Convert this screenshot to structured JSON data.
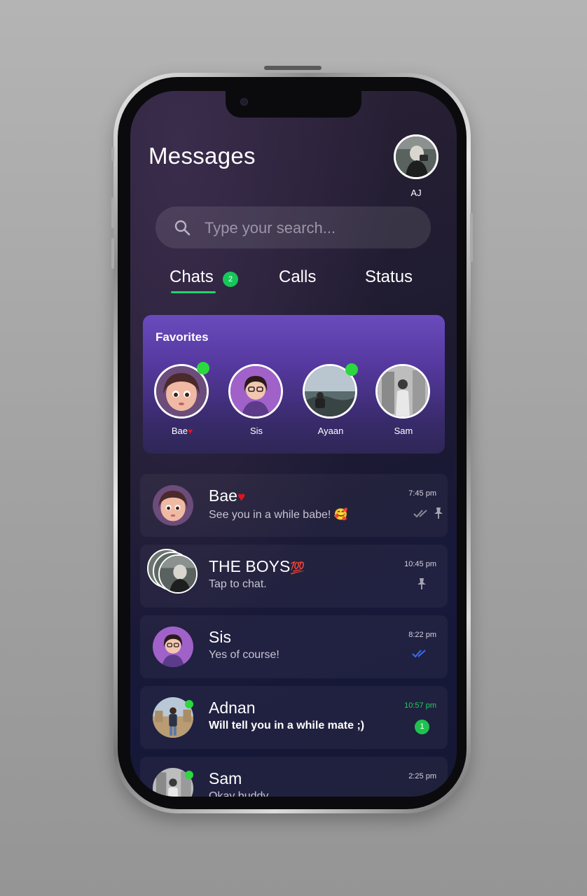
{
  "header": {
    "title": "Messages",
    "profile_initials": "AJ"
  },
  "search": {
    "placeholder": "Type your search..."
  },
  "tabs": [
    {
      "label": "Chats",
      "badge": "2",
      "active": true
    },
    {
      "label": "Calls"
    },
    {
      "label": "Status"
    }
  ],
  "favorites": {
    "title": "Favorites",
    "items": [
      {
        "name": "Bae",
        "emoji": "♥",
        "online": true
      },
      {
        "name": "Sis",
        "online": false
      },
      {
        "name": "Ayaan",
        "online": true
      },
      {
        "name": "Sam",
        "online": false
      }
    ]
  },
  "chats": [
    {
      "name": "Bae",
      "emoji": "♥",
      "message": "See you in a while babe! 🥰",
      "time": "7:45 pm",
      "status": "read-grey",
      "pinned": true
    },
    {
      "name": "THE BOYS",
      "emoji": "💯",
      "message": "Tap to chat.",
      "time": "10:45 pm",
      "pinned": true
    },
    {
      "name": "Sis",
      "message": "Yes of course!",
      "time": "8:22 pm",
      "status": "read-blue"
    },
    {
      "name": "Adnan",
      "message": "Will tell you in a while mate ;)",
      "time": "10:57 pm",
      "unread": "1",
      "online": true
    },
    {
      "name": "Sam",
      "message": "Okay buddy",
      "time": "2:25 pm",
      "online": true
    }
  ],
  "colors": {
    "accent_green": "#1fcf5c",
    "online_dot": "#2bd83f",
    "favorites_top": "#6a4bbd",
    "heart_red": "#e0141e",
    "read_blue": "#3a6df0"
  }
}
